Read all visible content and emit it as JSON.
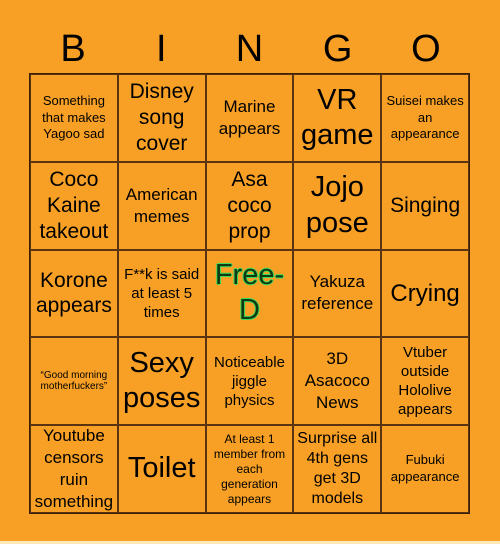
{
  "header": {
    "letters": [
      "B",
      "I",
      "N",
      "G",
      "O"
    ]
  },
  "board": {
    "background_color": "#F8A025",
    "free_space_glow_color": "#3DDC5A",
    "rows": [
      [
        {
          "text": "Something that makes Yagoo sad"
        },
        {
          "text": "Disney song cover"
        },
        {
          "text": "Marine appears"
        },
        {
          "text": "VR game"
        },
        {
          "text": "Suisei makes an appearance"
        }
      ],
      [
        {
          "text": "Coco Kaine takeout"
        },
        {
          "text": "American memes"
        },
        {
          "text": "Asa coco prop"
        },
        {
          "text": "Jojo pose"
        },
        {
          "text": "Singing"
        }
      ],
      [
        {
          "text": "Korone appears"
        },
        {
          "text": "F**k is said at least 5 times"
        },
        {
          "text": "Free-D",
          "free": true
        },
        {
          "text": "Yakuza reference"
        },
        {
          "text": "Crying"
        }
      ],
      [
        {
          "text": "“Good morning motherfuckers”"
        },
        {
          "text": "Sexy poses"
        },
        {
          "text": "Noticeable jiggle physics"
        },
        {
          "text": "3D Asacoco News"
        },
        {
          "text": "Vtuber outside Hololive appears"
        }
      ],
      [
        {
          "text": "Youtube censors ruin something"
        },
        {
          "text": "Toilet"
        },
        {
          "text": "At least 1 member from each generation appears"
        },
        {
          "text": "Surprise all 4th gens get 3D models"
        },
        {
          "text": "Fubuki appearance"
        }
      ]
    ]
  }
}
